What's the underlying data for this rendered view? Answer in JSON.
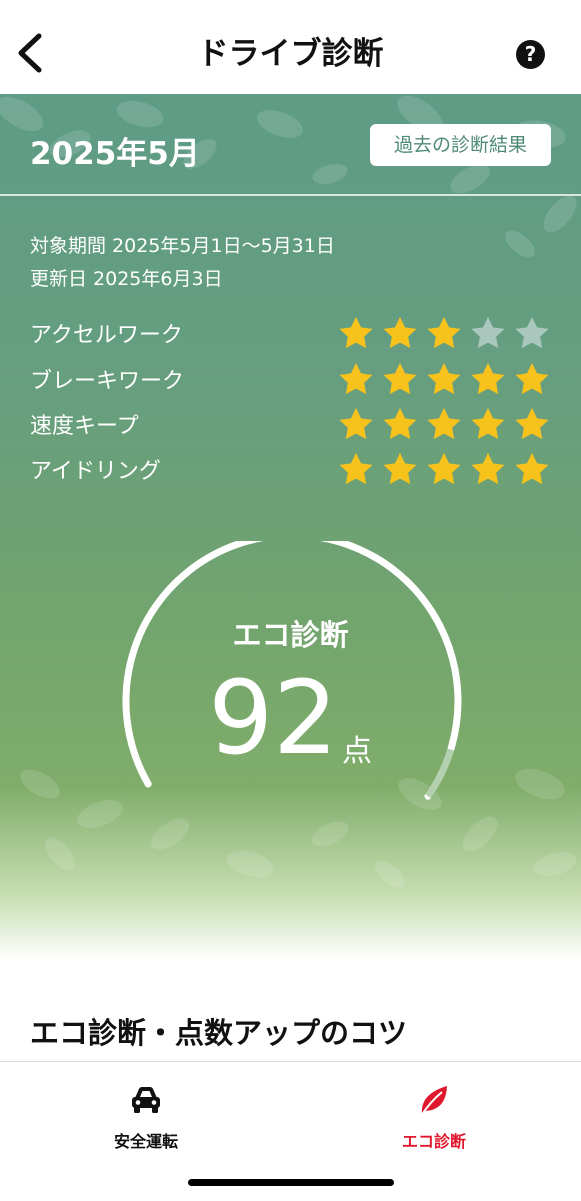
{
  "header": {
    "title": "ドライブ診断",
    "help_glyph": "?"
  },
  "summary": {
    "month": "2025年5月",
    "past_results_button": "過去の診断結果",
    "period": "対象期間 2025年5月1日〜5月31日",
    "updated": "更新日 2025年6月3日"
  },
  "ratings": [
    {
      "label": "アクセルワーク",
      "stars": 3,
      "max": 5
    },
    {
      "label": "ブレーキワーク",
      "stars": 5,
      "max": 5
    },
    {
      "label": "速度キープ",
      "stars": 5,
      "max": 5
    },
    {
      "label": "アイドリング",
      "stars": 5,
      "max": 5
    }
  ],
  "eco": {
    "label": "エコ診断",
    "score": "92",
    "unit": "点",
    "score_value": 92,
    "score_max": 100
  },
  "tips_title": "エコ診断・点数アップのコツ",
  "tabbar": {
    "tabs": [
      {
        "label": "安全運転",
        "icon": "car-icon",
        "active": false
      },
      {
        "label": "エコ診断",
        "icon": "leaf-icon",
        "active": true
      }
    ]
  },
  "colors": {
    "star_filled": "#f7c21c",
    "star_empty": "#a9c7bc",
    "active_tab": "#e0182d",
    "inactive_tab": "#111111"
  }
}
